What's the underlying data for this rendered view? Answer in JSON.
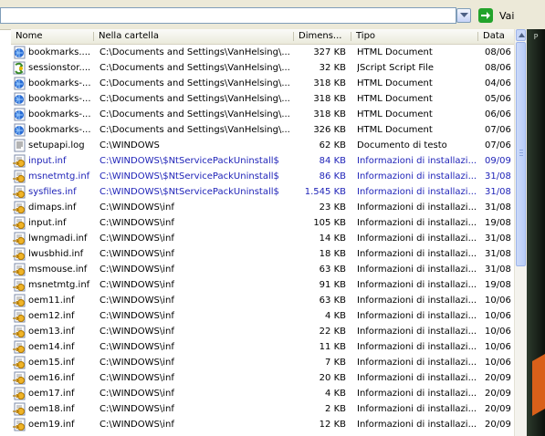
{
  "toolbar": {
    "address_value": "",
    "go_label": "Vai"
  },
  "columns": {
    "name": "Nome",
    "folder": "Nella cartella",
    "size": "Dimens...",
    "type": "Tipo",
    "date": "Data"
  },
  "rows": [
    {
      "icon": "html-document-icon",
      "name": "bookmarks....",
      "folder": "C:\\Documents and Settings\\VanHelsing\\...",
      "size": "327 KB",
      "type": "HTML Document",
      "date": "08/06",
      "blue": false
    },
    {
      "icon": "jscript-file-icon",
      "name": "sessionstor....",
      "folder": "C:\\Documents and Settings\\VanHelsing\\...",
      "size": "32 KB",
      "type": "JScript Script File",
      "date": "08/06",
      "blue": false
    },
    {
      "icon": "html-document-icon",
      "name": "bookmarks-...",
      "folder": "C:\\Documents and Settings\\VanHelsing\\...",
      "size": "318 KB",
      "type": "HTML Document",
      "date": "04/06",
      "blue": false
    },
    {
      "icon": "html-document-icon",
      "name": "bookmarks-...",
      "folder": "C:\\Documents and Settings\\VanHelsing\\...",
      "size": "318 KB",
      "type": "HTML Document",
      "date": "05/06",
      "blue": false
    },
    {
      "icon": "html-document-icon",
      "name": "bookmarks-...",
      "folder": "C:\\Documents and Settings\\VanHelsing\\...",
      "size": "318 KB",
      "type": "HTML Document",
      "date": "06/06",
      "blue": false
    },
    {
      "icon": "html-document-icon",
      "name": "bookmarks-...",
      "folder": "C:\\Documents and Settings\\VanHelsing\\...",
      "size": "326 KB",
      "type": "HTML Document",
      "date": "07/06",
      "blue": false
    },
    {
      "icon": "text-document-icon",
      "name": "setupapi.log",
      "folder": "C:\\WINDOWS",
      "size": "62 KB",
      "type": "Documento di testo",
      "date": "07/06",
      "blue": false
    },
    {
      "icon": "setup-info-icon",
      "name": "input.inf",
      "folder": "C:\\WINDOWS\\$NtServicePackUninstall$",
      "size": "84 KB",
      "type": "Informazioni di installazi...",
      "date": "09/09",
      "blue": true
    },
    {
      "icon": "setup-info-icon",
      "name": "msnetmtg.inf",
      "folder": "C:\\WINDOWS\\$NtServicePackUninstall$",
      "size": "86 KB",
      "type": "Informazioni di installazi...",
      "date": "31/08",
      "blue": true
    },
    {
      "icon": "setup-info-icon",
      "name": "sysfiles.inf",
      "folder": "C:\\WINDOWS\\$NtServicePackUninstall$",
      "size": "1.545 KB",
      "type": "Informazioni di installazi...",
      "date": "31/08",
      "blue": true
    },
    {
      "icon": "setup-info-icon",
      "name": "dimaps.inf",
      "folder": "C:\\WINDOWS\\inf",
      "size": "23 KB",
      "type": "Informazioni di installazi...",
      "date": "31/08",
      "blue": false
    },
    {
      "icon": "setup-info-icon",
      "name": "input.inf",
      "folder": "C:\\WINDOWS\\inf",
      "size": "105 KB",
      "type": "Informazioni di installazi...",
      "date": "19/08",
      "blue": false
    },
    {
      "icon": "setup-info-icon",
      "name": "lwngmadi.inf",
      "folder": "C:\\WINDOWS\\inf",
      "size": "14 KB",
      "type": "Informazioni di installazi...",
      "date": "31/08",
      "blue": false
    },
    {
      "icon": "setup-info-icon",
      "name": "lwusbhid.inf",
      "folder": "C:\\WINDOWS\\inf",
      "size": "18 KB",
      "type": "Informazioni di installazi...",
      "date": "31/08",
      "blue": false
    },
    {
      "icon": "setup-info-icon",
      "name": "msmouse.inf",
      "folder": "C:\\WINDOWS\\inf",
      "size": "63 KB",
      "type": "Informazioni di installazi...",
      "date": "31/08",
      "blue": false
    },
    {
      "icon": "setup-info-icon",
      "name": "msnetmtg.inf",
      "folder": "C:\\WINDOWS\\inf",
      "size": "91 KB",
      "type": "Informazioni di installazi...",
      "date": "19/08",
      "blue": false
    },
    {
      "icon": "setup-info-icon",
      "name": "oem11.inf",
      "folder": "C:\\WINDOWS\\inf",
      "size": "63 KB",
      "type": "Informazioni di installazi...",
      "date": "10/06",
      "blue": false
    },
    {
      "icon": "setup-info-icon",
      "name": "oem12.inf",
      "folder": "C:\\WINDOWS\\inf",
      "size": "4 KB",
      "type": "Informazioni di installazi...",
      "date": "10/06",
      "blue": false
    },
    {
      "icon": "setup-info-icon",
      "name": "oem13.inf",
      "folder": "C:\\WINDOWS\\inf",
      "size": "22 KB",
      "type": "Informazioni di installazi...",
      "date": "10/06",
      "blue": false
    },
    {
      "icon": "setup-info-icon",
      "name": "oem14.inf",
      "folder": "C:\\WINDOWS\\inf",
      "size": "11 KB",
      "type": "Informazioni di installazi...",
      "date": "10/06",
      "blue": false
    },
    {
      "icon": "setup-info-icon",
      "name": "oem15.inf",
      "folder": "C:\\WINDOWS\\inf",
      "size": "7 KB",
      "type": "Informazioni di installazi...",
      "date": "10/06",
      "blue": false
    },
    {
      "icon": "setup-info-icon",
      "name": "oem16.inf",
      "folder": "C:\\WINDOWS\\inf",
      "size": "20 KB",
      "type": "Informazioni di installazi...",
      "date": "20/09",
      "blue": false
    },
    {
      "icon": "setup-info-icon",
      "name": "oem17.inf",
      "folder": "C:\\WINDOWS\\inf",
      "size": "4 KB",
      "type": "Informazioni di installazi...",
      "date": "20/09",
      "blue": false
    },
    {
      "icon": "setup-info-icon",
      "name": "oem18.inf",
      "folder": "C:\\WINDOWS\\inf",
      "size": "2 KB",
      "type": "Informazioni di installazi...",
      "date": "20/09",
      "blue": false
    },
    {
      "icon": "setup-info-icon",
      "name": "oem19.inf",
      "folder": "C:\\WINDOWS\\inf",
      "size": "12 KB",
      "type": "Informazioni di installazi...",
      "date": "20/09",
      "blue": false
    }
  ],
  "colors": {
    "blue_text": "#1f23b8",
    "go_green": "#22a32b"
  }
}
